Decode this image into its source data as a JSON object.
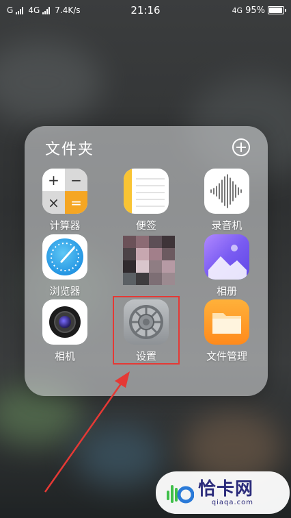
{
  "status_bar": {
    "carrier1": "G",
    "carrier2": "4G",
    "speed": "7.4K/s",
    "time": "21:16",
    "network": "4G",
    "battery": "95%",
    "battery_level": 0.95
  },
  "folder": {
    "title": "文件夹",
    "apps": [
      {
        "label": "计算器",
        "icon": "calculator-icon"
      },
      {
        "label": "便签",
        "icon": "notes-icon"
      },
      {
        "label": "录音机",
        "icon": "recorder-icon"
      },
      {
        "label": "浏览器",
        "icon": "browser-icon"
      },
      {
        "label": "",
        "icon": "obscured-app-icon"
      },
      {
        "label": "相册",
        "icon": "gallery-icon"
      },
      {
        "label": "相机",
        "icon": "camera-icon"
      },
      {
        "label": "设置",
        "icon": "settings-icon"
      },
      {
        "label": "文件管理",
        "icon": "files-icon"
      }
    ]
  },
  "watermark": {
    "name": "恰卡网",
    "url": "qiaqa.com"
  },
  "colors": {
    "highlight": "#e53935",
    "accent_orange": "#f5a623"
  }
}
